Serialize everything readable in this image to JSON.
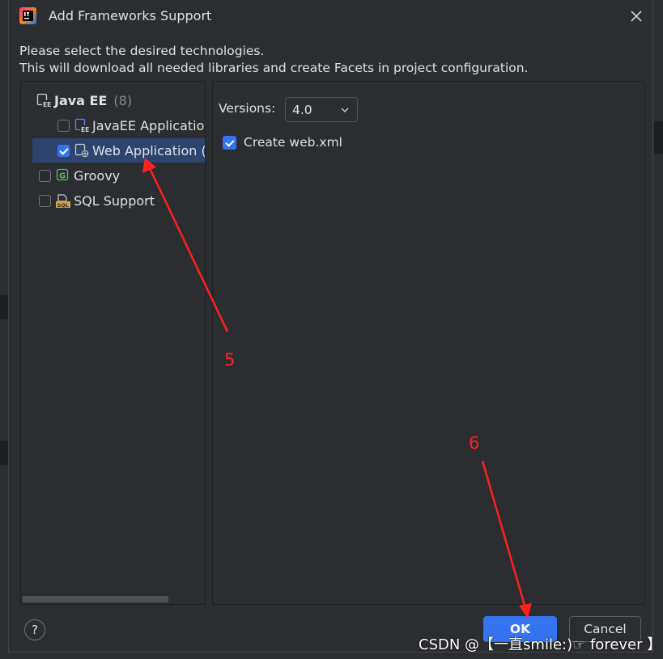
{
  "dialog": {
    "title": "Add Frameworks Support",
    "description_line1": "Please select the desired technologies.",
    "description_line2": "This will download all needed libraries and create Facets in project configuration."
  },
  "tree": {
    "group_label": "Java EE",
    "group_count": "(8)",
    "items": [
      {
        "label": "JavaEE Application",
        "checked": false,
        "icon": "javaee-app-icon"
      },
      {
        "label": "Web Application (",
        "checked": true,
        "icon": "web-app-icon"
      },
      {
        "label": "Groovy",
        "checked": false,
        "icon": "groovy-icon"
      },
      {
        "label": "SQL Support",
        "checked": false,
        "icon": "sql-icon"
      }
    ]
  },
  "settings": {
    "versions_label": "Versions:",
    "versions_value": "4.0",
    "create_webxml_label": "Create web.xml",
    "create_webxml_checked": true
  },
  "buttons": {
    "help": "?",
    "ok": "OK",
    "cancel": "Cancel"
  },
  "annotations": {
    "step5": "5",
    "step6": "6",
    "color": "#ff2020"
  },
  "watermark": "CSDN @【一直smile:)☞ forever 】",
  "colors": {
    "accent": "#3574f0",
    "selection": "#2e436e",
    "background": "#2b2d30"
  }
}
